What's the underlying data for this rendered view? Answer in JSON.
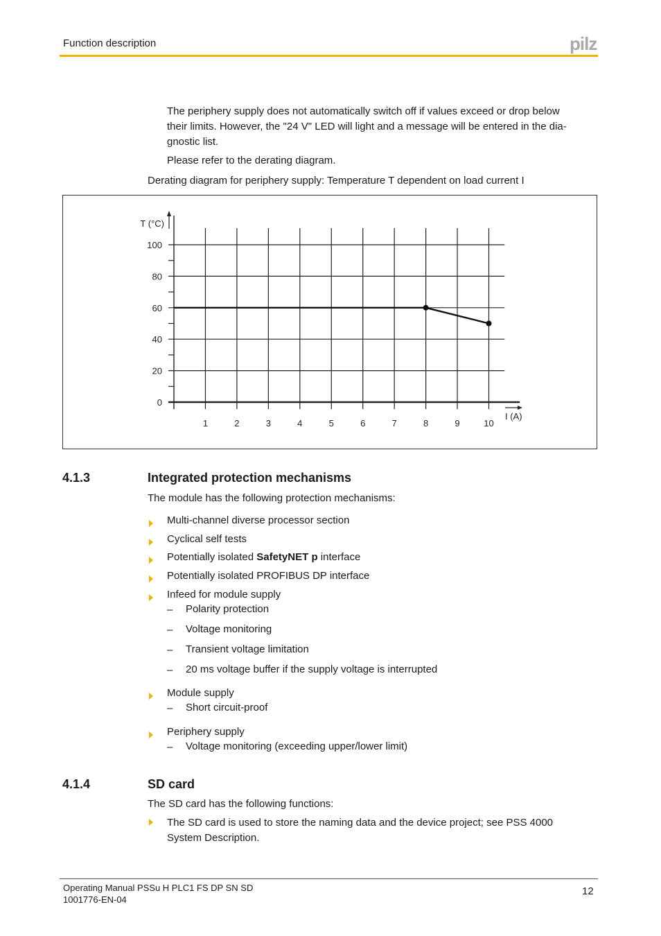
{
  "header": {
    "section_title": "Function description",
    "logo_text": "pilz",
    "accent_color": "#f0b400"
  },
  "intro": {
    "paragraph1_line1": "The periphery supply does not automatically switch off if values exceed or drop below",
    "paragraph1_line2": "their limits. However, the \"24 V\" LED will light and a message will be entered in the dia-",
    "paragraph1_line3": "gnostic list.",
    "paragraph2": "Please refer to the derating diagram.",
    "caption": "Derating diagram for periphery supply: Temperature T dependent on load current I"
  },
  "chart_data": {
    "type": "line",
    "title": "Derating diagram for periphery supply: Temperature T dependent on load current I",
    "xlabel": "I (A)",
    "ylabel": "T (°C)",
    "x_ticks": [
      1,
      2,
      3,
      4,
      5,
      6,
      7,
      8,
      9,
      10
    ],
    "y_ticks": [
      0,
      20,
      40,
      60,
      80,
      100
    ],
    "y_minor_ticks": [
      10,
      30,
      50,
      70,
      90
    ],
    "xlim": [
      0,
      10.5
    ],
    "ylim": [
      0,
      100
    ],
    "grid": true,
    "series": [
      {
        "name": "derating",
        "x": [
          0,
          8,
          10
        ],
        "y": [
          60,
          60,
          50
        ],
        "markers_at_x": [
          8,
          10
        ]
      }
    ]
  },
  "section_413": {
    "number": "4.1.3",
    "title": "Integrated protection mechanisms",
    "intro": "The module has the following protection mechanisms:",
    "items": [
      {
        "text": "Multi-channel diverse processor section"
      },
      {
        "text": "Cyclical self tests"
      },
      {
        "pre": "Potentially isolated ",
        "bold": "SafetyNET p",
        "post": " interface"
      },
      {
        "text": "Potentially isolated PROFIBUS DP interface"
      },
      {
        "text": "Infeed for module supply",
        "sub": [
          "Polarity protection",
          "Voltage monitoring",
          "Transient voltage limitation",
          "20 ms voltage buffer if the supply voltage is interrupted"
        ]
      },
      {
        "text": "Module supply",
        "sub": [
          "Short circuit-proof"
        ]
      },
      {
        "text": "Periphery supply",
        "sub": [
          "Voltage monitoring (exceeding upper/lower limit)"
        ]
      }
    ],
    "dash": "–"
  },
  "section_414": {
    "number": "4.1.4",
    "title": "SD card",
    "intro": "The SD card has the following functions:",
    "item_line1": "The SD card is used to store the naming data and the device project; see PSS 4000",
    "item_line2": "System Description."
  },
  "footer": {
    "manual_title": "Operating Manual PSSu H PLC1 FS DP SN SD",
    "doc_number": "1001776-EN-04",
    "page_number": "12"
  }
}
